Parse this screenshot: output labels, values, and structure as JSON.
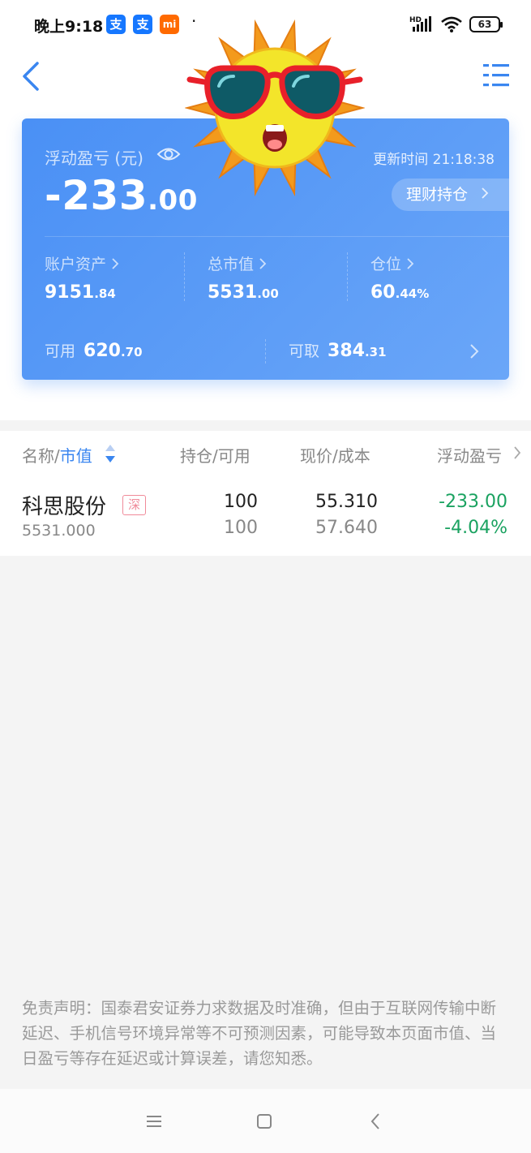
{
  "status_bar": {
    "time": "晚上9:18",
    "apps": [
      {
        "icon": "alipay-icon",
        "label": "支",
        "color": "#1677ff"
      },
      {
        "icon": "alipay-icon",
        "label": "支",
        "color": "#1677ff"
      },
      {
        "icon": "mi-icon",
        "label": "mi",
        "color": "#ff6a00"
      }
    ],
    "dot": "·",
    "network": "HD",
    "battery": "63"
  },
  "header": {
    "back_icon": "chevron-left-icon",
    "menu_icon": "list-menu-icon",
    "accent_color": "#3a86f0"
  },
  "summary": {
    "pnl_label": "浮动盈亏 (元)",
    "pnl_int": "-233",
    "pnl_dec": ".00",
    "update_time": "更新时间 21:18:38",
    "licai_label": "理财持仓",
    "stats": [
      {
        "label": "账户资产",
        "int": "9151",
        "dec": ".84"
      },
      {
        "label": "总市值",
        "int": "5531",
        "dec": ".00"
      },
      {
        "label": "仓位",
        "int": "60",
        "dec": ".44%"
      }
    ],
    "available_label": "可用",
    "available_int": "620",
    "available_dec": ".70",
    "withdrawable_label": "可取",
    "withdrawable_int": "384",
    "withdrawable_dec": ".31",
    "card_color": "#4a90f5"
  },
  "table": {
    "headers": {
      "name": "名称/",
      "name_sort": "市值",
      "position": "持仓/可用",
      "price": "现价/成本",
      "pnl": "浮动盈亏"
    },
    "rows": [
      {
        "name": "科思股份",
        "market": "深",
        "market_value": "5531.000",
        "holding": "100",
        "available": "100",
        "price": "55.310",
        "cost": "57.640",
        "pnl": "-233.00",
        "pnl_pct": "-4.04%"
      }
    ],
    "loss_color": "#1aa260"
  },
  "disclaimer": "免责声明：国泰君安证券力求数据及时准确，但由于互联网传输中断延迟、手机信号环境异常等不可预测因素，可能导致本页面市值、当日盈亏等存在延迟或计算误差，请您知悉。",
  "sticker": "sun-with-sunglasses-sticker",
  "nav_bar": {
    "icons": [
      "menu-icon",
      "home-square-icon",
      "back-icon"
    ]
  }
}
